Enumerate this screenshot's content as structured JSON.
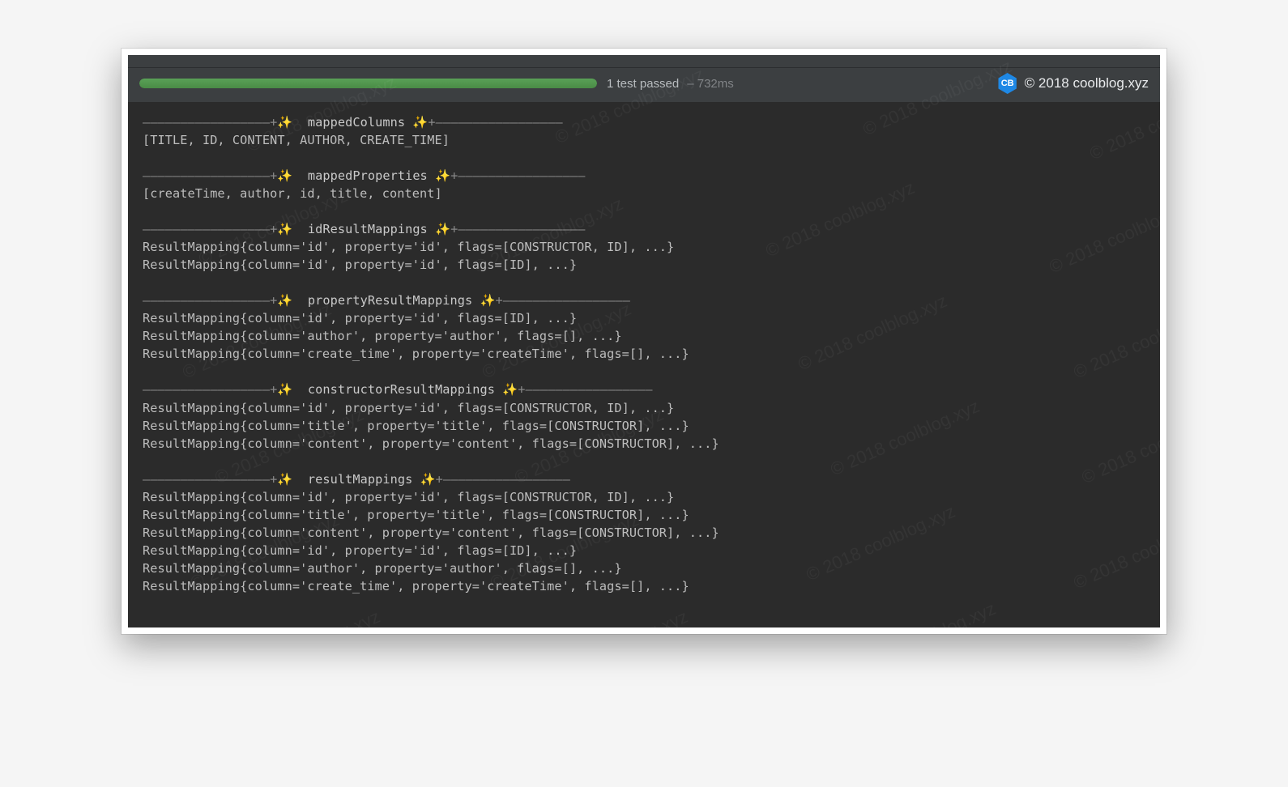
{
  "status": {
    "tests_passed": "1 test passed",
    "duration": "– 732ms"
  },
  "brand": {
    "badge": "CB",
    "text": "© 2018 coolblog.xyz"
  },
  "watermark_text": "© 2018 coolblog.xyz",
  "console": {
    "sections": [
      {
        "title": "mappedColumns",
        "lines": [
          "[TITLE, ID, CONTENT, AUTHOR, CREATE_TIME]"
        ]
      },
      {
        "title": "mappedProperties",
        "lines": [
          "[createTime, author, id, title, content]"
        ]
      },
      {
        "title": "idResultMappings",
        "lines": [
          "ResultMapping{column='id', property='id', flags=[CONSTRUCTOR, ID], ...}",
          "ResultMapping{column='id', property='id', flags=[ID], ...}"
        ]
      },
      {
        "title": "propertyResultMappings",
        "lines": [
          "ResultMapping{column='id', property='id', flags=[ID], ...}",
          "ResultMapping{column='author', property='author', flags=[], ...}",
          "ResultMapping{column='create_time', property='createTime', flags=[], ...}"
        ]
      },
      {
        "title": "constructorResultMappings",
        "lines": [
          "ResultMapping{column='id', property='id', flags=[CONSTRUCTOR, ID], ...}",
          "ResultMapping{column='title', property='title', flags=[CONSTRUCTOR], ...}",
          "ResultMapping{column='content', property='content', flags=[CONSTRUCTOR], ...}"
        ]
      },
      {
        "title": "resultMappings",
        "lines": [
          "ResultMapping{column='id', property='id', flags=[CONSTRUCTOR, ID], ...}",
          "ResultMapping{column='title', property='title', flags=[CONSTRUCTOR], ...}",
          "ResultMapping{column='content', property='content', flags=[CONSTRUCTOR], ...}",
          "ResultMapping{column='id', property='id', flags=[ID], ...}",
          "ResultMapping{column='author', property='author', flags=[], ...}",
          "ResultMapping{column='create_time', property='createTime', flags=[], ...}"
        ]
      }
    ]
  }
}
